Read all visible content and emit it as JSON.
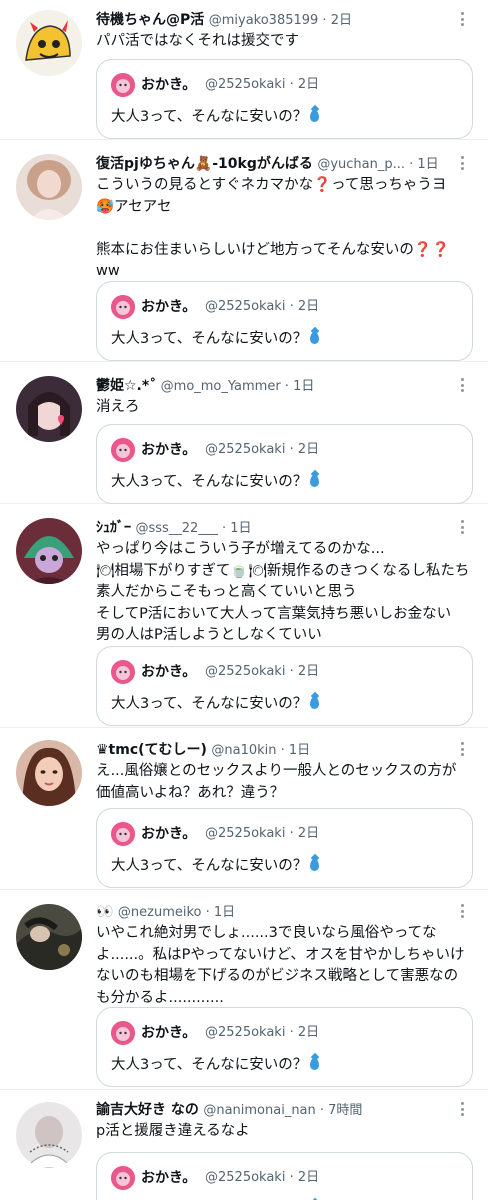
{
  "quoted": {
    "name": "おかき。",
    "handle": "@2525okaki · 2日",
    "text": "大人3って、そんなに安いの？",
    "emoji_icon": "droplet-icon"
  },
  "tweets": [
    {
      "name": "待機ちゃん@P活",
      "meta": "@miyako385199 · 2日",
      "body": "パパ活ではなくそれは援交です"
    },
    {
      "name": "復活pjゆちゃん🧸-10kgがんばる",
      "meta": "@yuchan_p... · 1日",
      "body": "こういうの見るとすぐネカマかな❓って思っちゃうヨ\n🥵アセアセ\n\n熊本にお住まいらしいけど地方ってそんな安いの❓❓\nww"
    },
    {
      "name": "鬱姫☆.*˚",
      "meta": "@mo_mo_Yammer · 1日",
      "body": "消えろ"
    },
    {
      "name": "ｼｭｶﾞｰ",
      "meta": "@sss__22___ · 1日",
      "body": "やっぱり今はこういう子が増えてるのかな...\n🍽相場下がりすぎて🍵🍽新規作るのきつくなるし私たち\n素人だからこそもっと高くていいと思う\nそしてP活において大人って言葉気持ち悪いしお金ない\n男の人はP活しようとしなくていい"
    },
    {
      "name": "♛tmc(てむしー)",
      "meta": "@na10kin · 1日",
      "body": "え...風俗嬢とのセックスより一般人とのセックスの方が\n価値高いよね？あれ？違う？"
    },
    {
      "name": "👀",
      "meta": "@nezumeiko · 1日",
      "body": "いやこれ絶対男でしょ......3で良いなら風俗やってな\nよ......。私はPやってないけど、オスを甘やかしちゃいけ\nないのも相場を下げるのがビジネス戦略として害悪なの\nも分かるよ............"
    },
    {
      "name": "諭吉大好き なの",
      "meta": "@nanimonai_nan · 7時間",
      "body": "p活と援履き違えるなよ"
    }
  ]
}
